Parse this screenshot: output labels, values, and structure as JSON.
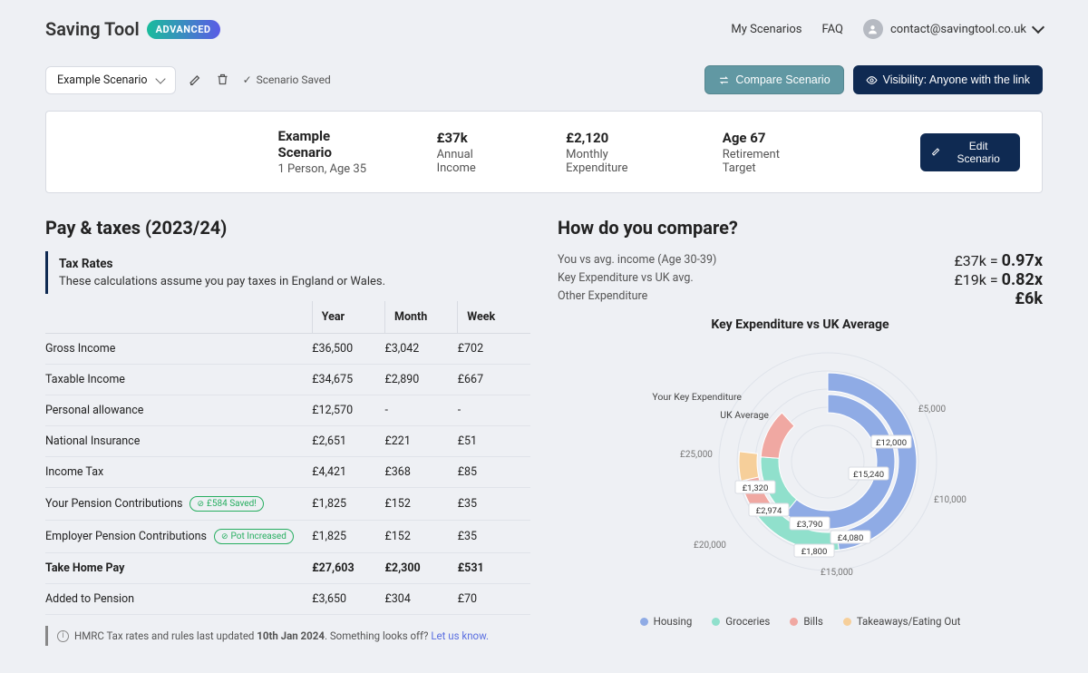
{
  "header": {
    "brand": "Saving Tool",
    "badge": "ADVANCED",
    "nav": {
      "scenarios": "My Scenarios",
      "faq": "FAQ"
    },
    "email": "contact@savingtool.co.uk"
  },
  "scenarioBar": {
    "selected": "Example Scenario",
    "savedLabel": "Scenario Saved",
    "compare": "Compare Scenario",
    "visibility": "Visibility: Anyone with the link"
  },
  "summary": {
    "name": "Example Scenario",
    "personLine": "1 Person, Age 35",
    "annualIncomeVal": "£37k",
    "annualIncomeLabel": "Annual Income",
    "monthlyExpVal": "£2,120",
    "monthlyExpLabel": "Monthly Expenditure",
    "retireVal": "Age 67",
    "retireLabel": "Retirement Target",
    "editBtn": "Edit Scenario"
  },
  "pay": {
    "heading": "Pay & taxes (2023/24)",
    "info": {
      "title": "Tax Rates",
      "desc": "These calculations assume you pay taxes in England or Wales."
    },
    "cols": {
      "year": "Year",
      "month": "Month",
      "week": "Week"
    },
    "rows": [
      {
        "label": "Gross Income",
        "year": "£36,500",
        "month": "£3,042",
        "week": "£702"
      },
      {
        "label": "Taxable Income",
        "year": "£34,675",
        "month": "£2,890",
        "week": "£667"
      },
      {
        "label": "Personal allowance",
        "year": "£12,570",
        "month": "-",
        "week": "-"
      },
      {
        "label": "National Insurance",
        "year": "£2,651",
        "month": "£221",
        "week": "£51"
      },
      {
        "label": "Income Tax",
        "year": "£4,421",
        "month": "£368",
        "week": "£85"
      },
      {
        "label": "Your Pension Contributions",
        "pill": "£584 Saved!",
        "year": "£1,825",
        "month": "£152",
        "week": "£35"
      },
      {
        "label": "Employer Pension Contributions",
        "pill": "Pot Increased",
        "year": "£1,825",
        "month": "£152",
        "week": "£35"
      },
      {
        "label": "Take Home Pay",
        "bold": true,
        "year": "£27,603",
        "month": "£2,300",
        "week": "£531"
      },
      {
        "label": "Added to Pension",
        "year": "£3,650",
        "month": "£304",
        "week": "£70"
      }
    ],
    "footnote": {
      "prefix": "HMRC Tax rates and rules last updated ",
      "date": "10th Jan 2024",
      "suffix": ". Something looks off? ",
      "link": "Let us know."
    }
  },
  "compare": {
    "heading": "How do you compare?",
    "labels": {
      "l1": "You vs avg. income (Age 30-39)",
      "l2": "Key Expenditure vs UK avg.",
      "l3": "Other Expenditure"
    },
    "vals": {
      "v1a": "£37k = ",
      "v1b": "0.97x",
      "v2a": "£19k = ",
      "v2b": "0.82x",
      "v3": "£6k"
    },
    "chartTitle": "Key Expenditure vs UK Average",
    "ringLabels": {
      "outer": "Your Key Expenditure",
      "inner": "UK Average"
    },
    "axis": {
      "t5": "£5,000",
      "t10": "£10,000",
      "t15": "£15,000",
      "t20": "£20,000",
      "t25": "£25,000"
    },
    "dataLabels": {
      "d1": "£12,000",
      "d2": "£15,240",
      "d3": "£4,080",
      "d4": "£1,800",
      "d5": "£3,790",
      "d6": "£2,974",
      "d7": "£1,320"
    },
    "legend": {
      "a": "Housing",
      "b": "Groceries",
      "c": "Bills",
      "d": "Takeaways/Eating Out"
    },
    "colors": {
      "housing": "#8fabe5",
      "groceries": "#90e0cc",
      "bills": "#f0a8a2",
      "takeaways": "#f6cf9a",
      "grid": "#dfe3ea"
    }
  },
  "chart_data": {
    "type": "pie",
    "title": "Key Expenditure vs UK Average",
    "series": [
      {
        "name": "Your Key Expenditure",
        "values": [
          12000,
          4080,
          1800,
          1320
        ]
      },
      {
        "name": "UK Average",
        "values": [
          15240,
          3790,
          2974,
          null
        ]
      }
    ],
    "categories": [
      "Housing",
      "Groceries",
      "Bills",
      "Takeaways/Eating Out"
    ],
    "axis_ticks": [
      5000,
      10000,
      15000,
      20000,
      25000
    ],
    "max": 25000
  }
}
